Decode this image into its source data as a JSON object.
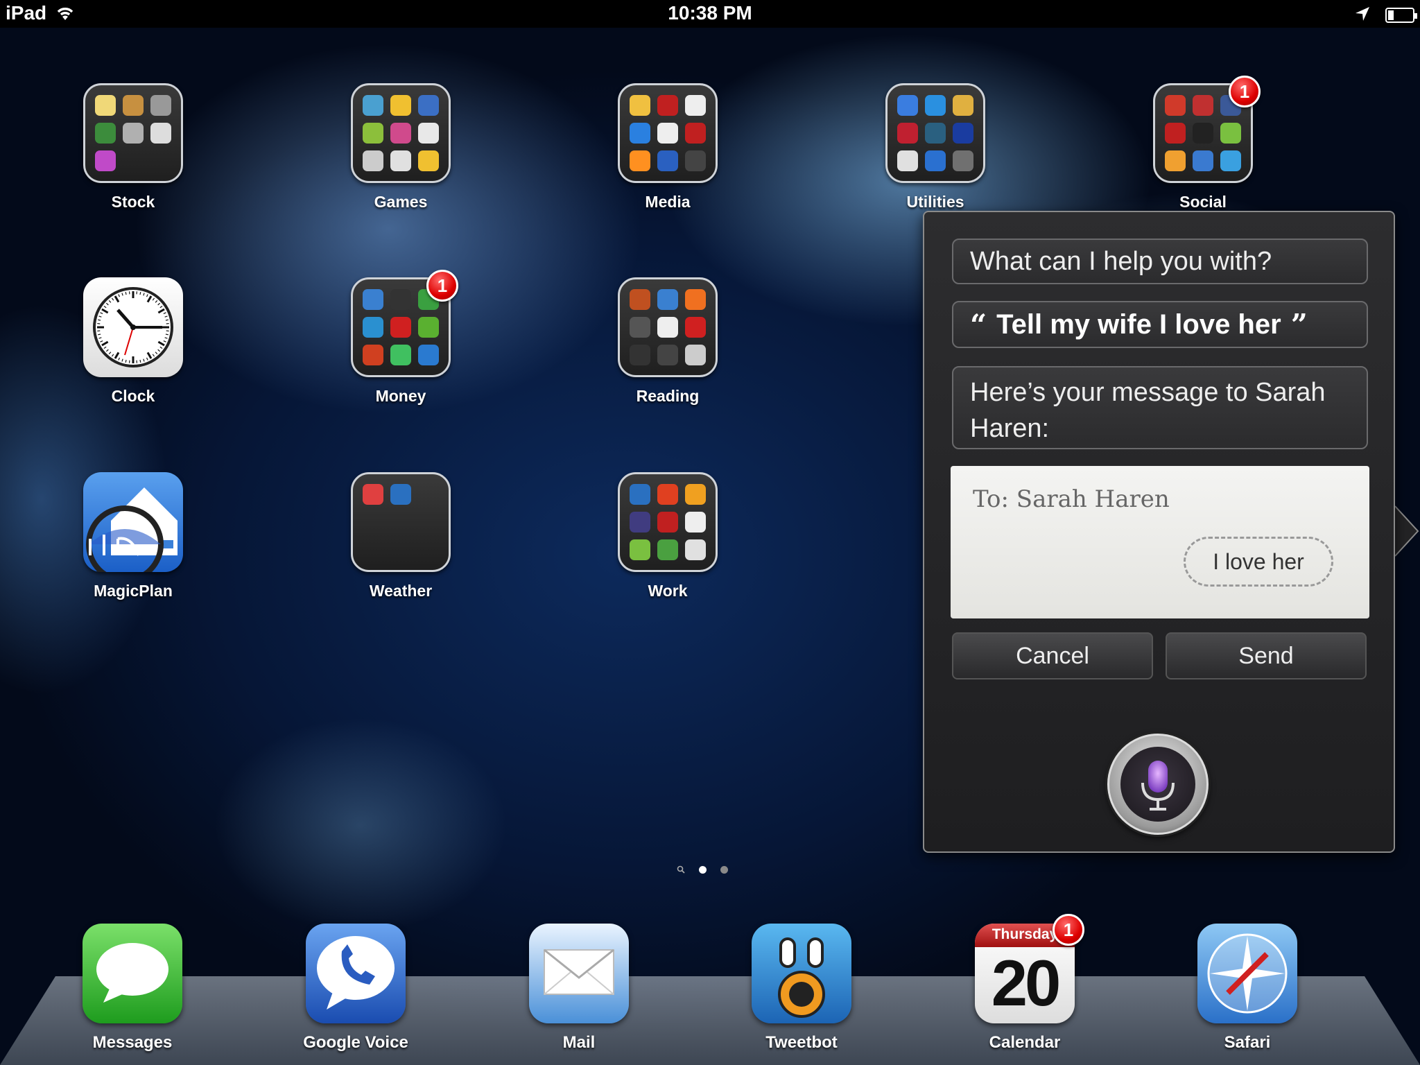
{
  "status_bar": {
    "carrier": "iPad",
    "time": "10:38 PM"
  },
  "home": {
    "rows": [
      [
        {
          "label": "Stock",
          "kind": "folder",
          "minis": [
            "#f0d878",
            "#c79040",
            "#999",
            "#3c8c3c",
            "#b0b0b0",
            "#ddd",
            "#c04ac8"
          ]
        },
        {
          "label": "Games",
          "kind": "folder",
          "minis": [
            "#4aa0d0",
            "#f0c030",
            "#3b6fc4",
            "#8cbf3b",
            "#d04a8c",
            "#e8e8e8",
            "#cccccc",
            "#e0e0e0",
            "#f0c030"
          ]
        },
        {
          "label": "Media",
          "kind": "folder",
          "minis": [
            "#f0c040",
            "#c02020",
            "#eeeeee",
            "#2a80e0",
            "#eeeeee",
            "#c02020",
            "#ff9020",
            "#2a60c0",
            "#444444"
          ]
        },
        {
          "label": "Utilities",
          "kind": "folder",
          "minis": [
            "#3a7de0",
            "#2a90e0",
            "#e0b040",
            "#c02030",
            "#2a6080",
            "#1a3ca0",
            "#e0e0e0",
            "#2a70d0",
            "#707070"
          ]
        },
        {
          "label": "Social",
          "kind": "folder",
          "badge": "1",
          "minis": [
            "#d03a2a",
            "#c03030",
            "#3b5998",
            "#c02020",
            "#222222",
            "#7ac040",
            "#f0a030",
            "#3a7ad0",
            "#3aa0e0"
          ]
        }
      ],
      [
        {
          "label": "Clock",
          "kind": "clock"
        },
        {
          "label": "Money",
          "kind": "folder",
          "badge": "1",
          "minis": [
            "#3a80d0",
            "#333333",
            "#3aa040",
            "#2a90d0",
            "#d02020",
            "#5ab030",
            "#d04020",
            "#40c060",
            "#2a7ad0"
          ]
        },
        {
          "label": "Reading",
          "kind": "folder",
          "minis": [
            "#c05020",
            "#3a80d0",
            "#f07020",
            "#555555",
            "#eeeeee",
            "#d02020",
            "#333333",
            "#444444",
            "#cccccc"
          ]
        }
      ],
      [
        {
          "label": "MagicPlan",
          "kind": "magic"
        },
        {
          "label": "Weather",
          "kind": "folder",
          "minis": [
            "#e04040",
            "#2a70c0"
          ]
        },
        {
          "label": "Work",
          "kind": "folder",
          "minis": [
            "#2a70c0",
            "#e04020",
            "#f0a020",
            "#403c80",
            "#c02020",
            "#eeeeee",
            "#7ac040",
            "#4aa040",
            "#e0e0e0"
          ]
        }
      ]
    ]
  },
  "page_dots": {
    "count": 2,
    "active": 1
  },
  "dock": [
    {
      "label": "Messages",
      "color1": "#7be06a",
      "color2": "#1e9c1e"
    },
    {
      "label": "Google Voice",
      "color1": "#6aa4f0",
      "color2": "#1a4cb0"
    },
    {
      "label": "Mail",
      "color1": "#eaf4ff",
      "color2": "#4a90d8"
    },
    {
      "label": "Tweetbot",
      "color1": "#5ab8f0",
      "color2": "#1c64b4"
    },
    {
      "label": "Calendar",
      "color1": "#ffffff",
      "color2": "#dddddd",
      "badge": "1",
      "day": "Thursday",
      "date": "20"
    },
    {
      "label": "Safari",
      "color1": "#8ec8f4",
      "color2": "#2a70c8"
    }
  ],
  "siri": {
    "prompt": "What can I help you with?",
    "utterance": "Tell my wife I love her",
    "open_quote": "“",
    "close_quote": "”",
    "response": "Here’s your message to Sarah Haren:",
    "message": {
      "to": "To: Sarah Haren",
      "body": "I love her"
    },
    "cancel_label": "Cancel",
    "send_label": "Send"
  }
}
